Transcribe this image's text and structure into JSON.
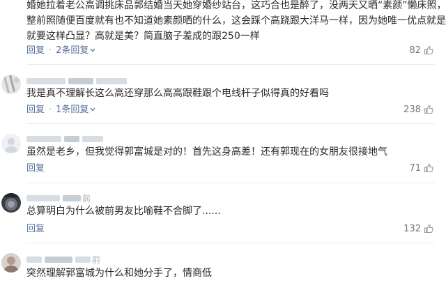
{
  "comments": [
    {
      "lines": [
        "婚她拉着老公高调挑床品郭结婚当天她穿婚纱站台，这巧合也是醉了，没两天又晒“素颜”懒床照，",
        "整前照随便百度就有也不知道她素颜晒的什么，这会踩个高跷跟大洋马一样，因为她唯一优点就是高",
        "就要这样凸显？高就是美？简直脑子差成的跟250一样"
      ],
      "reply_label": "回复",
      "replies_label": "2条回复",
      "likes": "82"
    },
    {
      "lines": [
        "我是真不理解长这么高还穿那么高高跟鞋跟个电线杆子似得真的好看吗"
      ],
      "reply_label": "回复",
      "replies_label": "1条回复",
      "likes": "238"
    },
    {
      "lines": [
        "虽然是老乡，但我觉得郭富城是对的！首先这身高差！还有郭现在的女朋友很接地气"
      ],
      "reply_label": "回复",
      "likes": "71"
    },
    {
      "time_hint": "前",
      "lines": [
        "总算明白为什么被前男友比喻鞋不合脚了......"
      ],
      "reply_label": "回复",
      "likes": "132"
    },
    {
      "time_hint": "前",
      "lines": [
        "突然理解郭富城为什么和她分手了，情商低"
      ]
    }
  ],
  "icons": {
    "like": "thumbs-up-icon",
    "replies_caret": "chevron-down-icon"
  },
  "colors": {
    "link": "#56729a",
    "text": "#2a2a2a",
    "muted": "#777777",
    "divider": "#ececec"
  }
}
